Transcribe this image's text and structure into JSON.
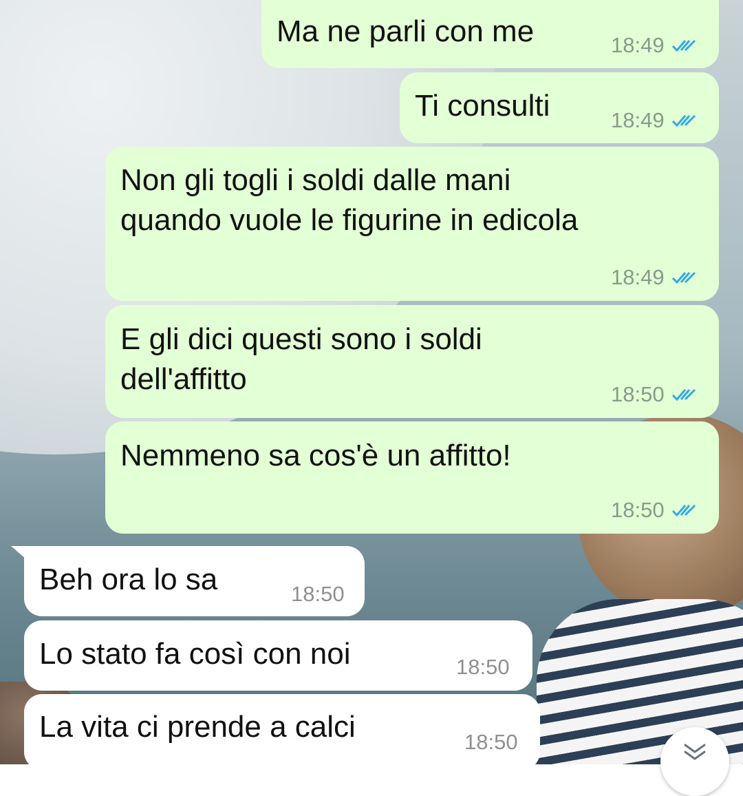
{
  "chat": {
    "messages": [
      {
        "direction": "outgoing",
        "text": "Ma ne parli con me",
        "time": "18:49",
        "status": "read"
      },
      {
        "direction": "outgoing",
        "text": "Ti consulti",
        "time": "18:49",
        "status": "read"
      },
      {
        "direction": "outgoing",
        "text": "Non gli togli i soldi dalle mani\nquando vuole le figurine in edicola",
        "time": "18:49",
        "status": "read"
      },
      {
        "direction": "outgoing",
        "text": "E gli dici questi sono i soldi\ndell'affitto",
        "time": "18:50",
        "status": "read"
      },
      {
        "direction": "outgoing",
        "text": "Nemmeno sa cos'è un affitto!",
        "time": "18:50",
        "status": "read"
      },
      {
        "direction": "incoming",
        "text": "Beh ora lo sa",
        "time": "18:50"
      },
      {
        "direction": "incoming",
        "text": "Lo stato fa così con noi",
        "time": "18:50"
      },
      {
        "direction": "incoming",
        "text": "La vita ci prende a calci",
        "time": "18:50"
      }
    ]
  },
  "colors": {
    "outgoing_bubble": "#e2ffd5",
    "incoming_bubble": "#ffffff",
    "read_ticks": "#34a8e6"
  },
  "icons": {
    "read_receipt": "double-check-icon",
    "scroll_down": "double-chevron-down-icon"
  }
}
